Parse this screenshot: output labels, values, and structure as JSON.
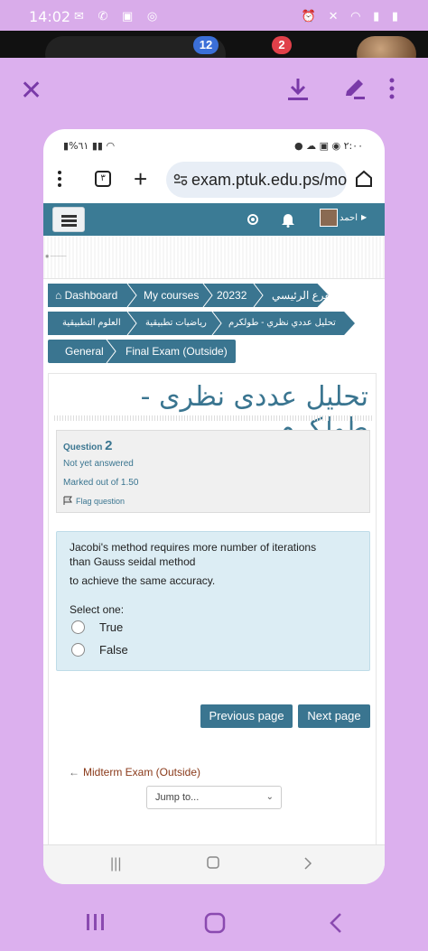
{
  "status_bar": {
    "time": "14:02"
  },
  "badges": {
    "blue_count": "12",
    "red_count": "2"
  },
  "inner_status": {
    "battery": "%٦١",
    "time": "٢:٠٠"
  },
  "browser": {
    "tab_count": "٣",
    "url": "exam.ptuk.edu.ps/moc"
  },
  "site_nav": {
    "user_name": "احمد"
  },
  "breadcrumb": {
    "row1": [
      "Dashboard",
      "My courses",
      "20232",
      "الفرع الرئيسي"
    ],
    "row2": [
      "العلوم التطبيقية",
      "رياضيات تطبيقية",
      "تحليل عددي نظري - طولكرم"
    ],
    "row3": [
      "General",
      "Final Exam (Outside)"
    ]
  },
  "page": {
    "title": "تحليل عددى نظرى - طولكرم"
  },
  "question_info": {
    "label": "Question",
    "number": "2",
    "state": "Not yet answered",
    "marked": "Marked out of 1.50",
    "flag": "Flag question"
  },
  "question": {
    "line1": "Jacobi's method requires more number of iterations",
    "line2": "than Gauss seidal  method",
    "line3": "to achieve the same accuracy.",
    "select_label": "Select one:",
    "options": [
      "True",
      "False"
    ]
  },
  "navigation": {
    "previous": "Previous page",
    "next": "Next page",
    "prev_activity": "Midterm Exam (Outside)",
    "jump_placeholder": "Jump to..."
  },
  "colors": {
    "primary": "#3a7590",
    "overlay": "#dcb0ee",
    "question_bg": "#dcedf4"
  }
}
